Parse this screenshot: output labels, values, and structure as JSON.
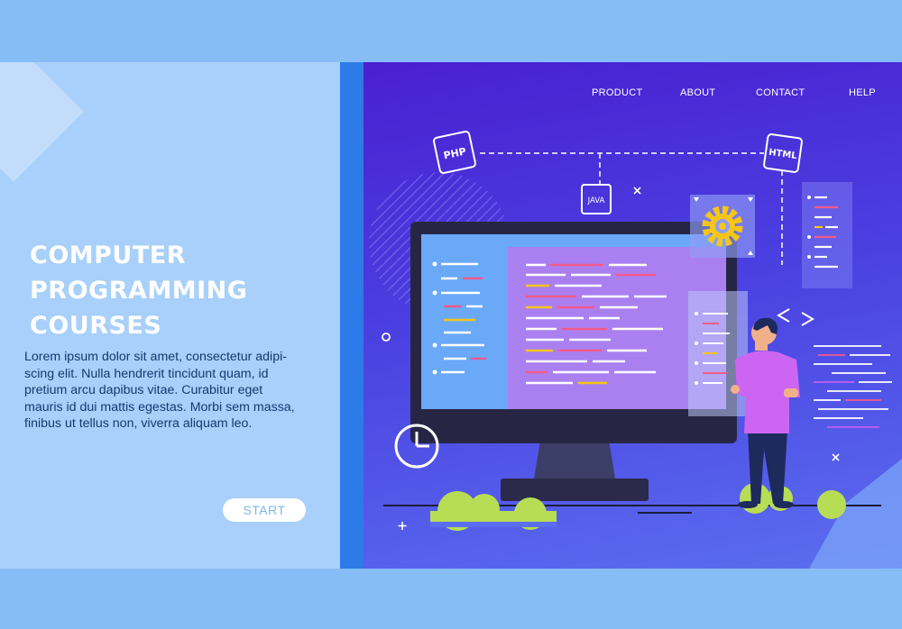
{
  "hero": {
    "title_lines": [
      "COMPUTER",
      "PROGRAMMING",
      "COURSES"
    ],
    "description": "Lorem ipsum dolor sit amet, consectetur adipi-scing elit. Nulla hendrerit tincidunt quam, id pretium arcu dapibus vitae. Curabitur eget mauris id dui mattis egestas. Morbi sem massa, finibus ut tellus non, viverra aliquam leo.",
    "start_label": "START"
  },
  "nav": {
    "items": [
      {
        "label": "PRODUCT"
      },
      {
        "label": "ABOUT"
      },
      {
        "label": "CONTACT"
      },
      {
        "label": "HELP"
      }
    ]
  },
  "illustration": {
    "tags": {
      "php": "PHP",
      "html": "HTML",
      "java": "JAVA"
    },
    "colors": {
      "background_top": "#4a1fd0",
      "background_bottom": "#5a6ef0",
      "screen": "#6aa8f8",
      "accent_pink": "#c55ef2",
      "gear": "#f5c518",
      "bush": "#b7dd55",
      "shirt": "#cc66f2"
    },
    "icons": [
      "gear-icon",
      "clock-icon",
      "code-brackets-icon",
      "close-icon",
      "plus-icon"
    ]
  }
}
